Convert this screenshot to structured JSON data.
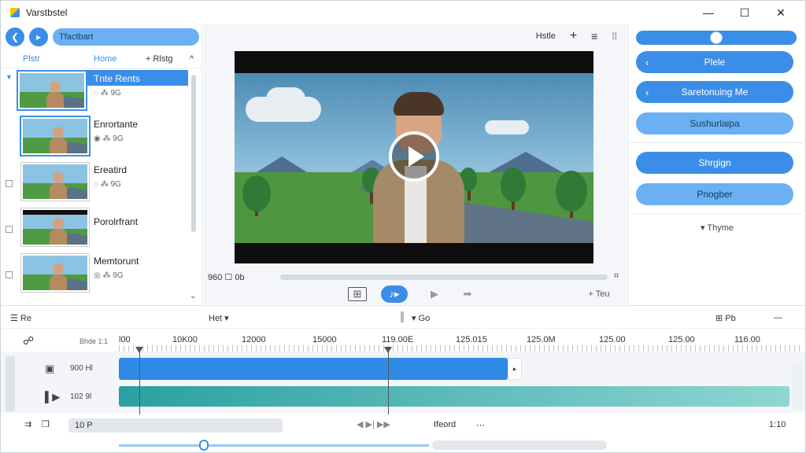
{
  "window": {
    "title": "Varstbstel",
    "minimize": "—",
    "maximize": "☐",
    "close": "✕"
  },
  "left": {
    "path": "Tfactbart",
    "headers": {
      "col1": "Plstr",
      "col2": "Home",
      "add": "+ Rlstg",
      "sort": "^"
    },
    "items": [
      {
        "name": "Tnte Rents",
        "meta": "◌ ⁂ 9G"
      },
      {
        "name": "Enrortante",
        "meta": "◉ ⁂ 9G"
      },
      {
        "name": "Ereatird",
        "meta": "◌ ⁂ 9G"
      },
      {
        "name": "Porolrfrant",
        "meta": ""
      },
      {
        "name": "Memtorunt",
        "meta": "◎ ⁂ 9G"
      }
    ]
  },
  "center": {
    "toolbar": {
      "label": "Hstle",
      "add": "+",
      "list": "≡",
      "grid": "⁞⁞"
    },
    "progress": {
      "left": "960 ☐  0b",
      "right": "⌗",
      "fraction": 0.0
    },
    "controls": {
      "add_clip": "⊞",
      "add_text": "+ Teu",
      "play": "▶",
      "forward": "➡"
    }
  },
  "right": {
    "slider_value": 0.5,
    "buttons": [
      {
        "label": "Plele",
        "arrow": "‹"
      },
      {
        "label": "Saretonuing Me",
        "arrow": "‹"
      },
      {
        "label": "Sushurlaipa",
        "arrow": ""
      },
      {
        "label": "Shrgign",
        "arrow": ""
      },
      {
        "label": "Pnogber",
        "arrow": ""
      }
    ],
    "theme": "▾ Thyme"
  },
  "timeline": {
    "top": {
      "left": "☰ Re",
      "mid": "Het ▾",
      "mid2": "▾  Go",
      "right": "⊞ Pb",
      "dash": "—"
    },
    "ruler_left": "Bhde 1:1",
    "ruler_labels": [
      "l00",
      "10K00",
      "12000",
      "15000",
      "119.00E",
      "125.015",
      "125.0M",
      "125.00",
      "125.00",
      "116.00"
    ],
    "tracks": [
      {
        "label": "900 Hl"
      },
      {
        "label": "102 9l"
      }
    ],
    "bottom": {
      "zoom": "10 P",
      "center": "◀ ▶| ▶▶",
      "record": "Ifeord",
      "dash": "⋯",
      "time": "1:10"
    }
  }
}
